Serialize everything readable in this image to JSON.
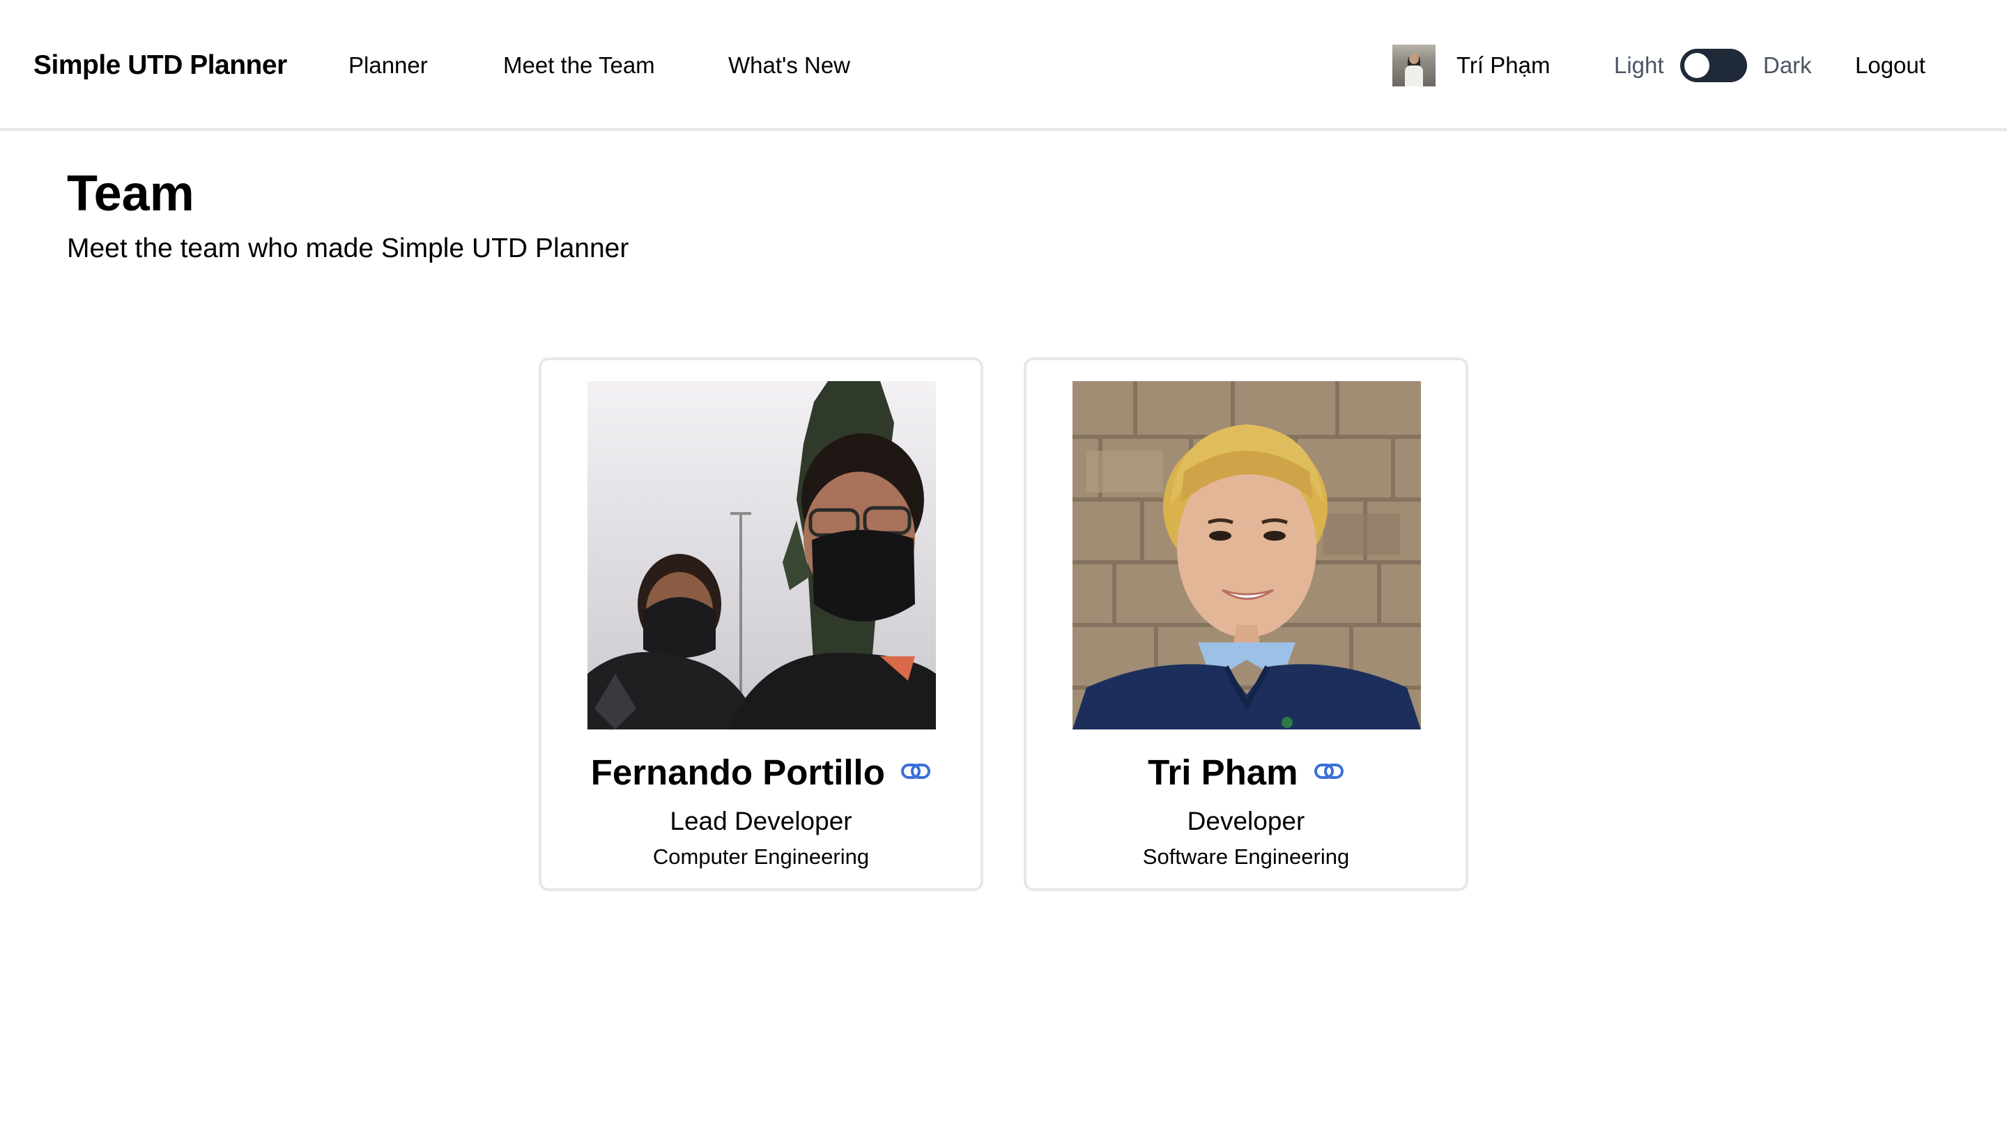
{
  "nav": {
    "brand": "Simple UTD Planner",
    "links": [
      "Planner",
      "Meet the Team",
      "What's New"
    ],
    "user_name": "Trí Phạm",
    "theme_light_label": "Light",
    "theme_dark_label": "Dark",
    "theme_mode": "light",
    "logout_label": "Logout"
  },
  "page": {
    "title": "Team",
    "subtitle": "Meet the team who made Simple UTD Planner"
  },
  "team": [
    {
      "name": "Fernando Portillo",
      "role": "Lead Developer",
      "major": "Computer Engineering",
      "icon": "link-icon"
    },
    {
      "name": "Tri Pham",
      "role": "Developer",
      "major": "Software Engineering",
      "icon": "link-icon"
    }
  ],
  "colors": {
    "link_icon": "#3b6fd8",
    "toggle_bg": "#1f2937",
    "border": "#e5e7eb"
  }
}
